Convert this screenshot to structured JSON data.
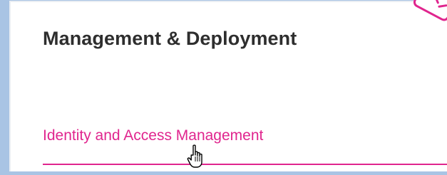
{
  "section": {
    "title": "Management & Deployment"
  },
  "links": [
    {
      "label": "Identity and Access Management"
    }
  ],
  "colors": {
    "accent": "#e0258e",
    "heading": "#2e2e2e",
    "background": "#a9c4e4",
    "card": "#ffffff"
  },
  "icons": {
    "corner": "tag-icon",
    "pointer": "hand-cursor-icon"
  }
}
